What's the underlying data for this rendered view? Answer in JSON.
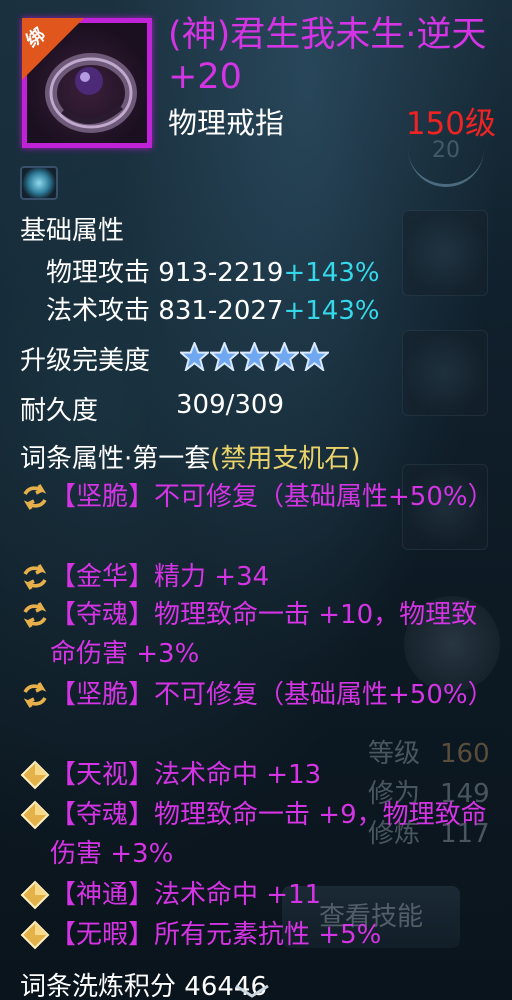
{
  "item": {
    "bind_badge": "绑",
    "name": "(神)君生我未生·逆天 +20",
    "type": "物理戒指",
    "level": "150级"
  },
  "base": {
    "heading": "基础属性",
    "stats": [
      {
        "label": "物理攻击",
        "value": "913-2219",
        "bonus": "+143%"
      },
      {
        "label": "法术攻击",
        "value": "831-2027",
        "bonus": "+143%"
      }
    ]
  },
  "upgrade": {
    "label": "升级完美度",
    "stars": 5
  },
  "durability": {
    "label": "耐久度",
    "value": "309/309"
  },
  "affix_heading": {
    "prefix": "词条属性·第一套",
    "suffix": "(禁用支机石)"
  },
  "affixes": [
    {
      "icon": "swirl-icon",
      "tag": "【坚脆】",
      "text": "不可修复（基础属性+50%）"
    },
    {
      "icon": "swirl-icon",
      "tag": "【金华】",
      "text": "精力 +34"
    },
    {
      "icon": "swirl-icon",
      "tag": "【夺魂】",
      "text": "物理致命一击 +10，物理致命伤害 +3%"
    },
    {
      "icon": "swirl-icon",
      "tag": "【坚脆】",
      "text": "不可修复（基础属性+50%）"
    },
    {
      "icon": "diamond-icon",
      "tag": "【天视】",
      "text": "法术命中 +13"
    },
    {
      "icon": "diamond-icon",
      "tag": "【夺魂】",
      "text": "物理致命一击 +9，物理致命伤害 +3%"
    },
    {
      "icon": "diamond-icon",
      "tag": "【神通】",
      "text": "法术命中 +11"
    },
    {
      "icon": "diamond-icon",
      "tag": "【无暇】",
      "text": "所有元素抗性 +5%"
    }
  ],
  "refine_score": {
    "label": "词条洗炼积分",
    "value": "46446"
  },
  "background": {
    "badge_20": "20",
    "stats": [
      {
        "label": "等级",
        "value": "160"
      },
      {
        "label": "修为",
        "value": "149"
      },
      {
        "label": "修炼",
        "value": "117"
      }
    ],
    "button": "查看技能"
  },
  "colors": {
    "name": "#d534e5",
    "level": "#ee2424",
    "bonus": "#34d8e8",
    "heading_suffix": "#e9d36a"
  }
}
